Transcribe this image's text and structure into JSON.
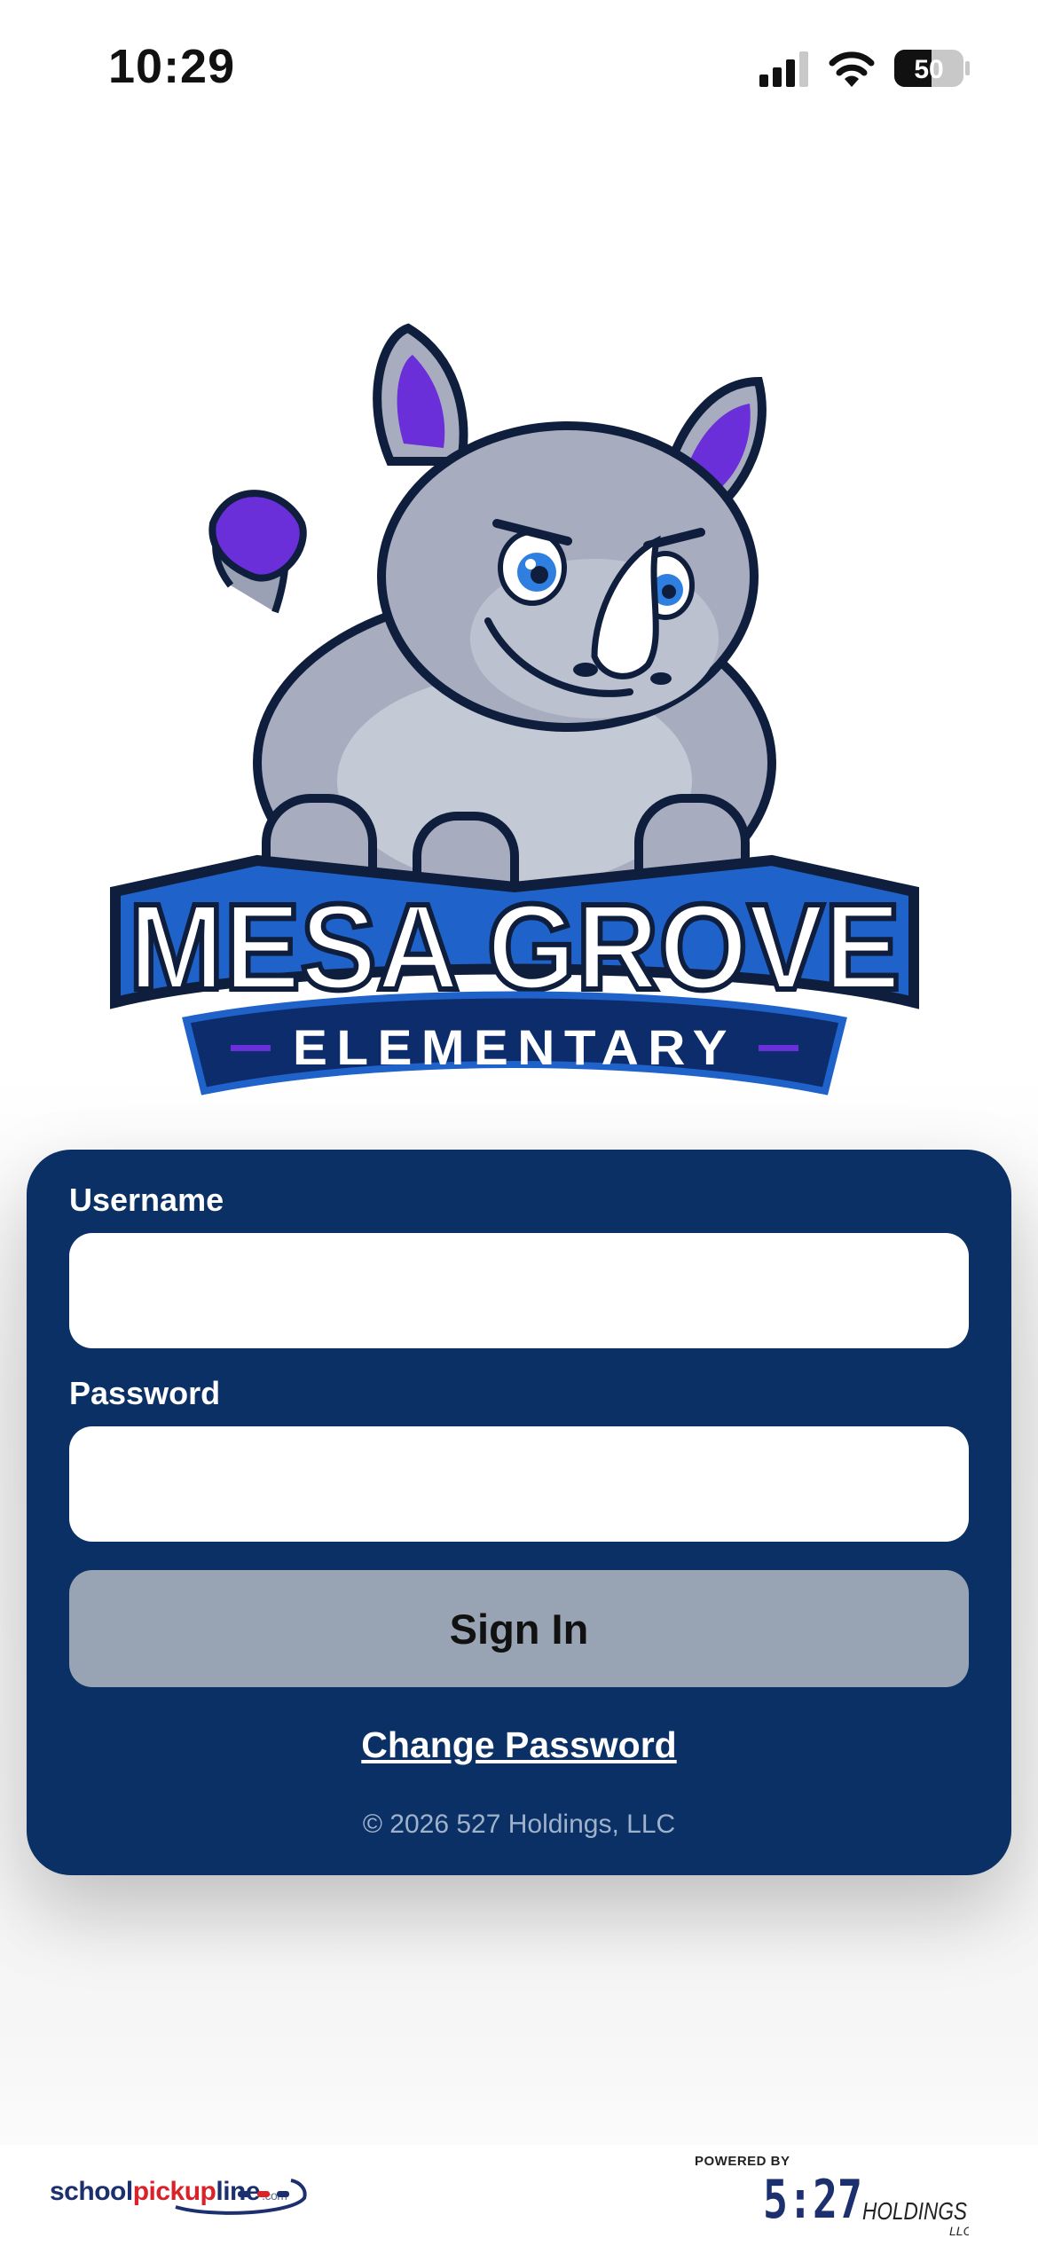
{
  "status_bar": {
    "time": "10:29",
    "battery_percent": "50"
  },
  "logo": {
    "school_name": "MESA GROVE",
    "school_type": "ELEMENTARY",
    "mascot": "rhino-mascot"
  },
  "login": {
    "username_label": "Username",
    "username_value": "",
    "password_label": "Password",
    "password_value": "",
    "sign_in_label": "Sign In",
    "change_password_label": "Change Password",
    "copyright": "© 2026 527 Holdings, LLC"
  },
  "footer": {
    "spl_school": "school",
    "spl_pickup": "pickup",
    "spl_line": "line",
    "spl_com": ".com",
    "powered_by": "POWERED BY",
    "holdings_digits": "5:27",
    "holdings_word": "HOLDINGS",
    "holdings_llc": "LLC"
  },
  "colors": {
    "card": "#0b3066",
    "button": "#98a4b3",
    "accent_purple": "#6a2fd8",
    "brand_red": "#d8232a"
  }
}
